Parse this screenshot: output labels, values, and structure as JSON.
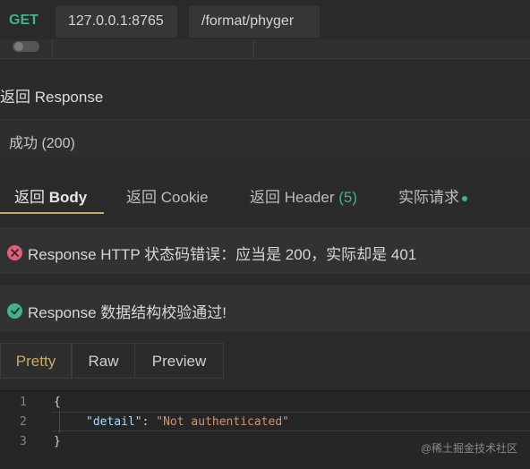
{
  "request": {
    "method": "GET",
    "host": "127.0.0.1:8765",
    "path": "/format/phyger"
  },
  "response": {
    "title": "返回 Response",
    "status": "成功 (200)"
  },
  "tabs": {
    "body_prefix": "返回 ",
    "body_strong": "Body",
    "cookie": "返回 Cookie",
    "header": "返回 Header ",
    "header_count": "(5)",
    "actual": "实际请求"
  },
  "messages": {
    "error": "Response HTTP 状态码错误：应当是 200，实际却是 401",
    "success": "Response 数据结构校验通过!"
  },
  "view_tabs": {
    "pretty": "Pretty",
    "raw": "Raw",
    "preview": "Preview"
  },
  "code": {
    "line_numbers": [
      "1",
      "2",
      "3"
    ],
    "open_brace": "{",
    "key": "\"detail\"",
    "colon": ": ",
    "value": "\"Not authenticated\"",
    "close_brace": "}"
  },
  "watermark": "@稀土掘金技术社区",
  "colors": {
    "accent_green": "#3fb38b",
    "accent_gold": "#c9a86a",
    "error_red": "#e0607a"
  }
}
